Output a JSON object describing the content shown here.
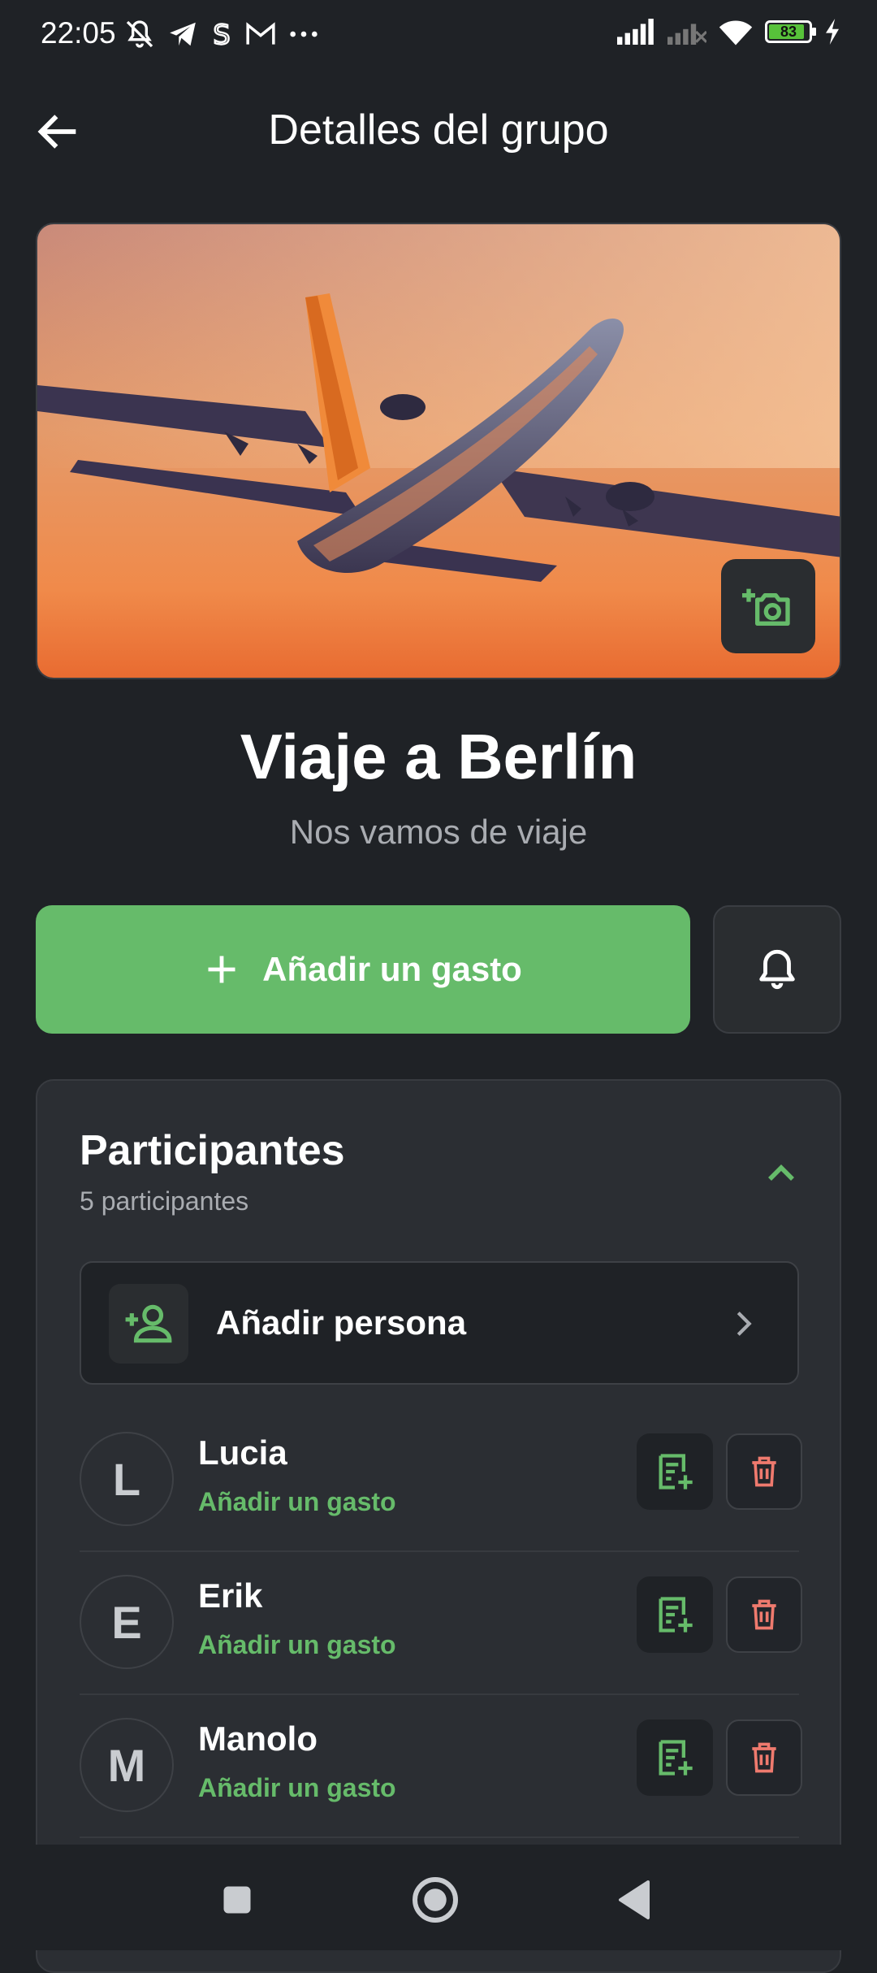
{
  "status_bar": {
    "time": "22:05",
    "battery": "83",
    "left_icons": [
      "mute-icon",
      "telegram-icon",
      "s-app-icon",
      "gmail-icon",
      "more-dots-icon"
    ],
    "right_icons": [
      "signal-icon",
      "signal-off-icon",
      "wifi-icon",
      "battery-icon",
      "charging-icon"
    ]
  },
  "header": {
    "title": "Detalles del grupo",
    "back_icon": "arrow-left-icon"
  },
  "group": {
    "name": "Viaje a Berlín",
    "description": "Nos vamos de viaje",
    "image": "airplane-sunset-photo",
    "camera_icon": "add-photo-icon"
  },
  "actions": {
    "add_expense_label": "Añadir un gasto",
    "add_icon": "plus-icon",
    "bell_icon": "bell-icon"
  },
  "participants": {
    "title": "Participantes",
    "subtitle": "5 participantes",
    "add_person_label": "Añadir persona",
    "list": [
      {
        "initial": "L",
        "name": "Lucia",
        "action": "Añadir un gasto"
      },
      {
        "initial": "E",
        "name": "Erik",
        "action": "Añadir un gasto"
      },
      {
        "initial": "M",
        "name": "Manolo",
        "action": "Añadir un gasto"
      }
    ]
  },
  "colors": {
    "background": "#1f2226",
    "card": "#2b2e33",
    "accent_green": "#66bb6a",
    "delete_red": "#ef7a6e"
  }
}
